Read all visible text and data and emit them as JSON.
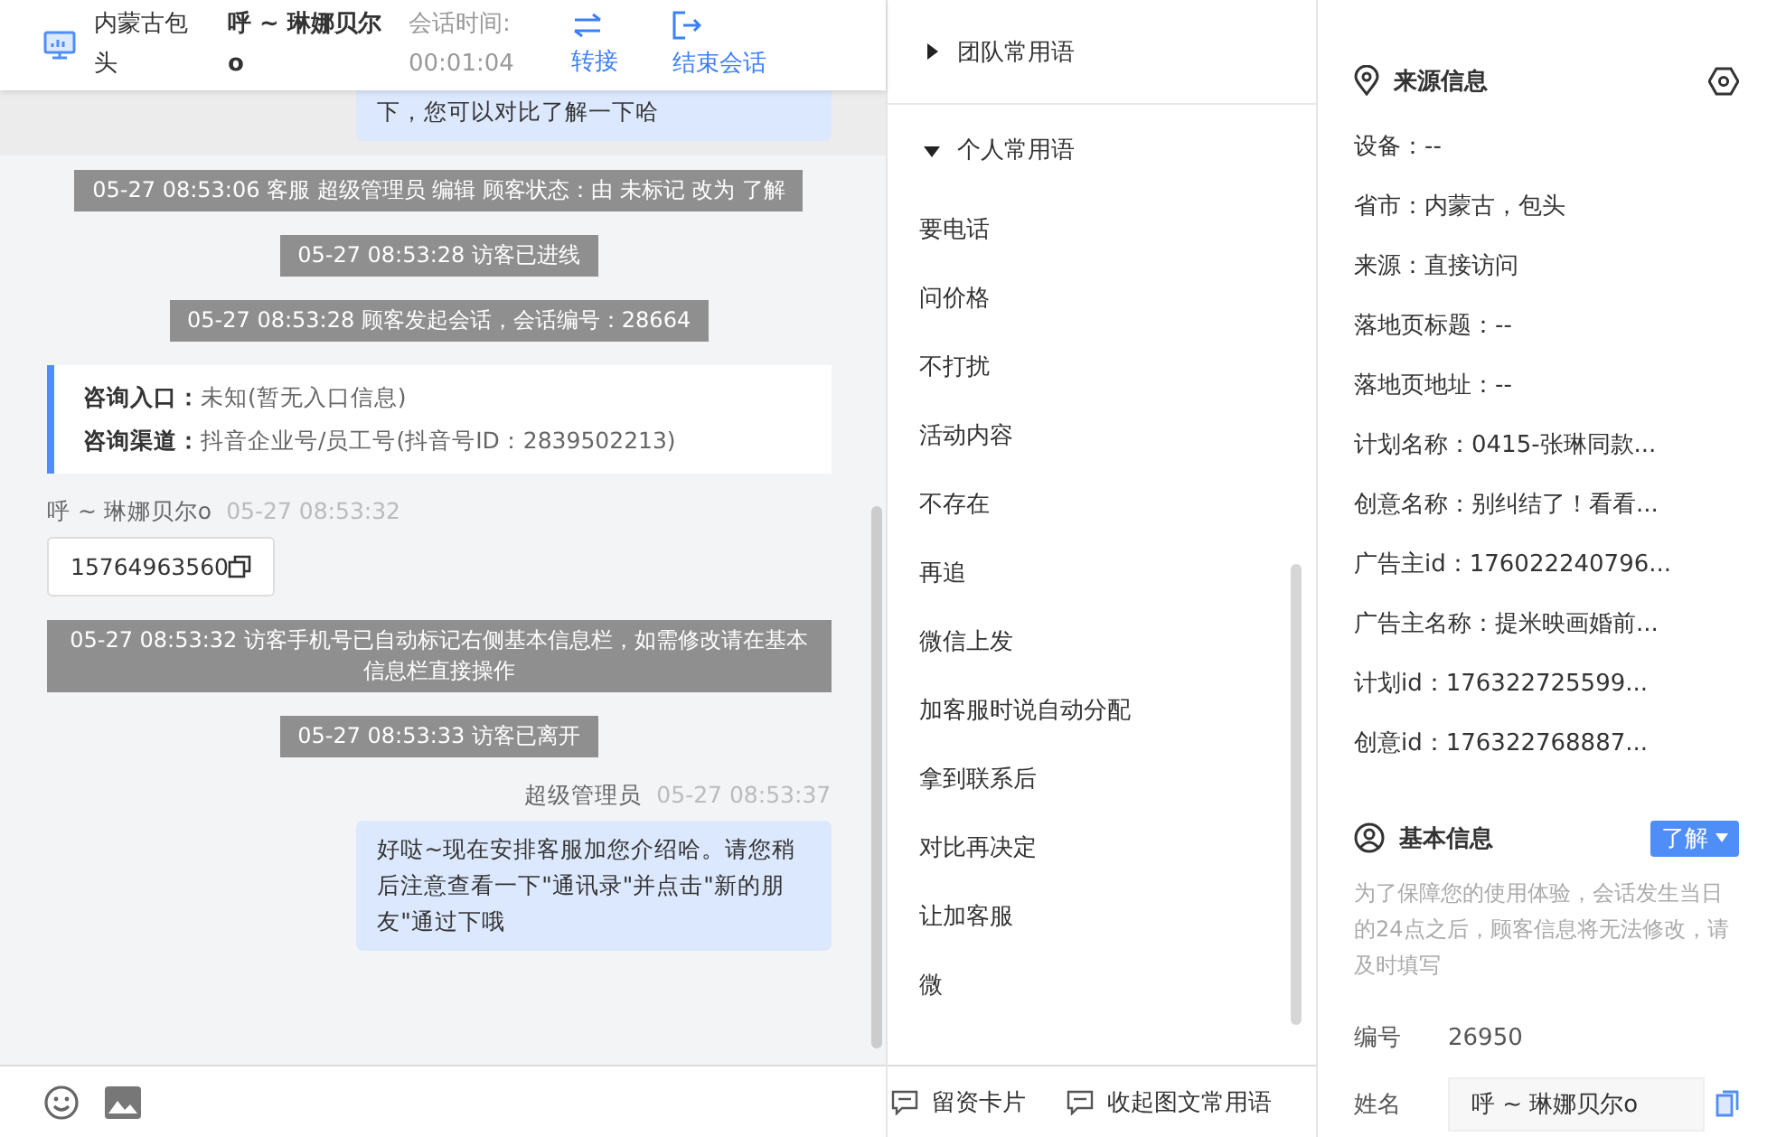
{
  "header": {
    "location": "内蒙古包头",
    "visitor": "呼 ~ 琳娜贝尔o",
    "session_time_label": "会话时间:",
    "session_time": "00:01:04",
    "actions": [
      {
        "kind": "transfer",
        "label": "转接"
      },
      {
        "kind": "end",
        "label": "结束会话"
      }
    ]
  },
  "messages": [
    {
      "kind": "earlier_bubble",
      "text": "下，您可以对比了解一下哈"
    },
    {
      "kind": "system",
      "text": "05-27 08:53:06 客服 超级管理员 编辑 顾客状态：由 未标记 改为 了解"
    },
    {
      "kind": "system",
      "text": "05-27 08:53:28 访客已进线"
    },
    {
      "kind": "system",
      "text": "05-27 08:53:28 顾客发起会话，会话编号：28664"
    },
    {
      "kind": "entry_card",
      "rows": [
        {
          "label": "咨询入口：",
          "value": "未知(暂无入口信息)"
        },
        {
          "label": "咨询渠道：",
          "value": "抖音企业号/员工号(抖音号ID：2839502213)"
        }
      ]
    },
    {
      "kind": "visitor",
      "sender": "呼 ~ 琳娜贝尔o",
      "time": "05-27 08:53:32",
      "text": "15764963560"
    },
    {
      "kind": "system",
      "text": "05-27 08:53:32 访客手机号已自动标记右侧基本信息栏，如需修改请在基本信息栏直接操作"
    },
    {
      "kind": "system",
      "text": "05-27 08:53:33 访客已离开"
    },
    {
      "kind": "agent",
      "sender": "超级管理员",
      "time": "05-27 08:53:37",
      "text": "好哒~现在安排客服加您介绍哈。请您稍后注意查看一下\"通讯录\"并点击\"新的朋友\"通过下哦"
    }
  ],
  "phrase_groups": [
    {
      "title": "团队常用语",
      "expanded": false
    },
    {
      "title": "个人常用语",
      "expanded": true,
      "items": [
        "要电话",
        "问价格",
        "不打扰",
        "活动内容",
        "不存在",
        "再追",
        "微信上发",
        "加客服时说自动分配",
        "拿到联系后",
        "对比再决定",
        "让加客服",
        "微"
      ]
    }
  ],
  "phrase_toolbar": [
    {
      "label": "留资卡片"
    },
    {
      "label": "收起图文常用语"
    }
  ],
  "source_info": {
    "title": "来源信息",
    "rows": [
      "设备：--",
      "省市：内蒙古，包头",
      "来源：直接访问",
      "落地页标题：--",
      "落地页地址：--",
      "计划名称：0415-张琳同款...",
      "创意名称：别纠结了！看看...",
      "广告主id：176022240796...",
      "广告主名称：提米映画婚前...",
      "计划id：176322725599...",
      "创意id：176322768887..."
    ]
  },
  "basic_info": {
    "title": "基本信息",
    "status": "了解",
    "notice": "为了保障您的使用体验，会话发生当日的24点之后，顾客信息将无法修改，请及时填写",
    "fields": [
      {
        "kind": "text",
        "label": "编号",
        "value": "26950"
      },
      {
        "kind": "input",
        "label": "姓名",
        "value": "呼 ~ 琳娜贝尔o"
      }
    ]
  }
}
